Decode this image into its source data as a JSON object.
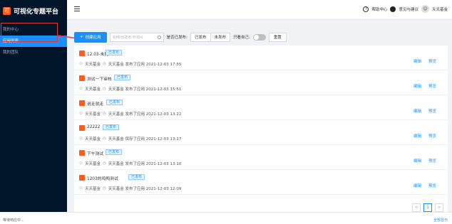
{
  "app": {
    "title": "可视化专题平台",
    "logo_text": "可"
  },
  "sidebar": {
    "items": [
      {
        "label": "我的中心"
      },
      {
        "label": "应用列表"
      },
      {
        "label": "我的团队"
      }
    ]
  },
  "header": {
    "help": "帮助中心",
    "feedback": "意见与建议",
    "user": "天天基金"
  },
  "toolbar": {
    "create_label": "创建应用",
    "create_icon": "+",
    "search_placeholder": "名称/创建者/专题id",
    "published_label": "是否已发布:",
    "filter_published": "已发布",
    "filter_unpublished": "未发布",
    "only_mine": "只看自己:",
    "reset_label": "重置"
  },
  "rows": [
    {
      "title": "12.03-未提",
      "badge": "已发布",
      "author": "天天基金",
      "activity": "天天基金 发布了应用 2021-12-03 17:55",
      "edit": "编辑",
      "preview": "预览"
    },
    {
      "title": "测试一下审核",
      "badge": "已发布",
      "author": "天天基金",
      "activity": "天天基金 发布了应用 2021-12-03 15:51",
      "edit": "编辑",
      "preview": "预览"
    },
    {
      "title": "说走就走",
      "badge": "已发布",
      "author": "天天基金",
      "activity": "天天基金 发布了应用 2021-12-03 13:22",
      "edit": "编辑",
      "preview": "预览"
    },
    {
      "title": "22222",
      "badge": "已发布",
      "author": "天天基金",
      "activity": "天天基金 保存了应用 2021-12-03 13:17",
      "edit": "编辑",
      "preview": "预览"
    },
    {
      "title": "下午测试",
      "badge": "已发布",
      "author": "天天基金",
      "activity": "天天基金 发布了应用 2021-12-03 13:10",
      "edit": "编辑",
      "preview": "预览"
    },
    {
      "title": "1203的鸡鸭测试",
      "badge": "已发布",
      "author": "天天基金",
      "activity": "天天基金 发布了应用 2021-12-03 12:09",
      "edit": "编辑",
      "preview": "预览"
    }
  ],
  "pagination": {
    "prev": "<",
    "current": "1",
    "next": ">"
  },
  "footer": {
    "left": "等待响应中...",
    "right": "全部显示"
  }
}
